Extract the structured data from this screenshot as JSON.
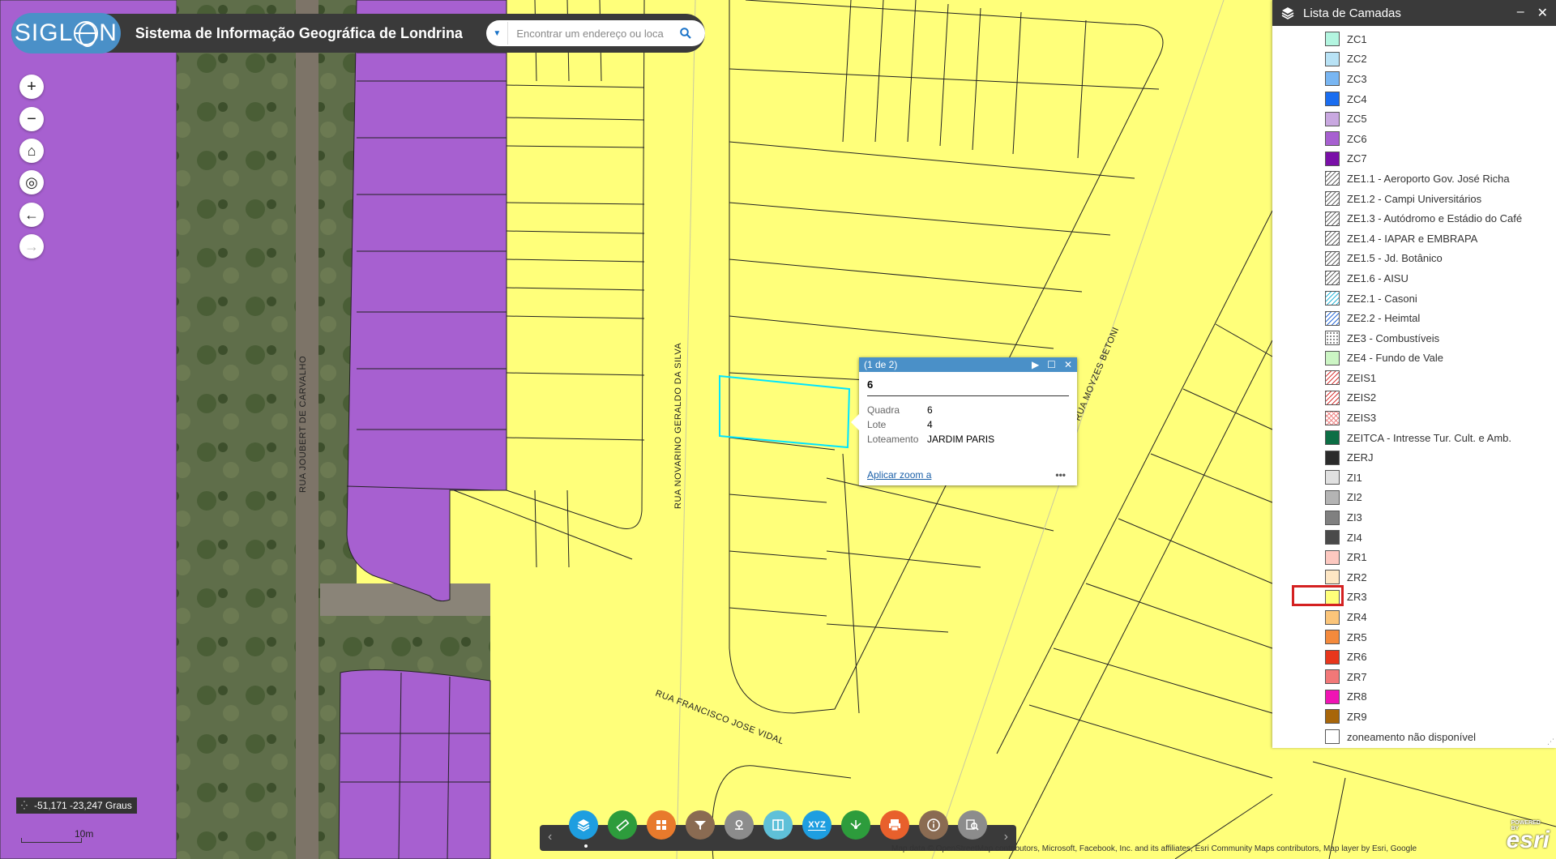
{
  "header": {
    "logo_text": "SIGLON",
    "title": "Sistema de Informação Geográfica de Londrina",
    "search_placeholder": "Encontrar um endereço ou loca"
  },
  "nav": [
    {
      "name": "zoom-in-button",
      "glyph": "+"
    },
    {
      "name": "zoom-out-button",
      "glyph": "−"
    },
    {
      "name": "home-button",
      "glyph": "⌂"
    },
    {
      "name": "locate-button",
      "glyph": "◎"
    },
    {
      "name": "back-extent-button",
      "glyph": "←"
    },
    {
      "name": "forward-extent-button",
      "glyph": "→"
    }
  ],
  "map": {
    "streets": [
      "RUA JOUBERT DE CARVALHO",
      "RUA NOVARINO GERALDO DA SILVA",
      "RUA FRANCISCO JOSE VIDAL",
      "RUA MOYZES BETONI"
    ],
    "colors": {
      "zone_yellow": "#ffff7a",
      "zone_purple": "#a760d0",
      "selection": "#00e5ff"
    }
  },
  "coords": {
    "text": "-51,171 -23,247 Graus"
  },
  "scale": {
    "label": "10m"
  },
  "popup": {
    "counter": "(1 de 2)",
    "title": "6",
    "rows": [
      {
        "key": "Quadra",
        "value": "6"
      },
      {
        "key": "Lote",
        "value": "4"
      },
      {
        "key": "Loteamento",
        "value": "JARDIM PARIS"
      }
    ],
    "zoom_link": "Aplicar zoom a",
    "more": "•••"
  },
  "panel": {
    "title": "Lista de Camadas",
    "items": [
      {
        "label": "ZC1",
        "color": "#b3f5e0",
        "pattern": ""
      },
      {
        "label": "ZC2",
        "color": "#b8e2f5",
        "pattern": ""
      },
      {
        "label": "ZC3",
        "color": "#79b6f2",
        "pattern": ""
      },
      {
        "label": "ZC4",
        "color": "#1a6df0",
        "pattern": ""
      },
      {
        "label": "ZC5",
        "color": "#c9a8e0",
        "pattern": ""
      },
      {
        "label": "ZC6",
        "color": "#a760d0",
        "pattern": ""
      },
      {
        "label": "ZC7",
        "color": "#7a10a8",
        "pattern": ""
      },
      {
        "label": "ZE1.1 - Aeroporto Gov. José Richa",
        "color": "#ffffff",
        "pattern": "hatch"
      },
      {
        "label": "ZE1.2 - Campi Universitários",
        "color": "#ffffff",
        "pattern": "hatch"
      },
      {
        "label": "ZE1.3 - Autódromo e Estádio do Café",
        "color": "#ffffff",
        "pattern": "hatch"
      },
      {
        "label": "ZE1.4 - IAPAR e EMBRAPA",
        "color": "#ffffff",
        "pattern": "hatch"
      },
      {
        "label": "ZE1.5 - Jd. Botânico",
        "color": "#ffffff",
        "pattern": "hatch"
      },
      {
        "label": "ZE1.6 - AISU",
        "color": "#ffffff",
        "pattern": "hatch"
      },
      {
        "label": "ZE2.1 - Casoni",
        "color": "#ffffff",
        "pattern": "hatch-cyan"
      },
      {
        "label": "ZE2.2 - Heimtal",
        "color": "#ffffff",
        "pattern": "hatch-blue"
      },
      {
        "label": "ZE3 - Combustíveis",
        "color": "#ffffff",
        "pattern": "dots"
      },
      {
        "label": "ZE4 - Fundo de Vale",
        "color": "#ccf5c4",
        "pattern": ""
      },
      {
        "label": "ZEIS1",
        "color": "#ffffff",
        "pattern": "hatch-red"
      },
      {
        "label": "ZEIS2",
        "color": "#ffffff",
        "pattern": "hatch-red"
      },
      {
        "label": "ZEIS3",
        "color": "#ffffff",
        "pattern": "cross-red"
      },
      {
        "label": "ZEITCA - Intresse Tur. Cult. e Amb.",
        "color": "#0d6e45",
        "pattern": ""
      },
      {
        "label": "ZERJ",
        "color": "#2b2b2b",
        "pattern": ""
      },
      {
        "label": "ZI1",
        "color": "#e0e0e0",
        "pattern": ""
      },
      {
        "label": "ZI2",
        "color": "#b4b4b4",
        "pattern": ""
      },
      {
        "label": "ZI3",
        "color": "#808080",
        "pattern": ""
      },
      {
        "label": "ZI4",
        "color": "#4a4a4a",
        "pattern": ""
      },
      {
        "label": "ZR1",
        "color": "#fcc8c0",
        "pattern": ""
      },
      {
        "label": "ZR2",
        "color": "#fde6c4",
        "pattern": ""
      },
      {
        "label": "ZR3",
        "color": "#ffff7a",
        "pattern": ""
      },
      {
        "label": "ZR4",
        "color": "#fbc57a",
        "pattern": ""
      },
      {
        "label": "ZR5",
        "color": "#f48a3c",
        "pattern": ""
      },
      {
        "label": "ZR6",
        "color": "#e8361c",
        "pattern": ""
      },
      {
        "label": "ZR7",
        "color": "#f27878",
        "pattern": ""
      },
      {
        "label": "ZR8",
        "color": "#f014b4",
        "pattern": ""
      },
      {
        "label": "ZR9",
        "color": "#a8660a",
        "pattern": ""
      },
      {
        "label": "zoneamento não disponível",
        "color": "#ffffff",
        "pattern": ""
      }
    ]
  },
  "toolbar": {
    "tools": [
      {
        "name": "layers-tool",
        "color": "#1e9ee0",
        "glyph": "layers"
      },
      {
        "name": "measure-tool",
        "color": "#2d9c3c",
        "glyph": "ruler"
      },
      {
        "name": "basemap-tool",
        "color": "#e87a2c",
        "glyph": "grid"
      },
      {
        "name": "query-tool",
        "color": "#8a6b52",
        "glyph": "filter"
      },
      {
        "name": "locate-tool",
        "color": "#8c8c8c",
        "glyph": "pin"
      },
      {
        "name": "swipe-tool",
        "color": "#5fc0d8",
        "glyph": "swipe"
      },
      {
        "name": "coordinates-tool",
        "color": "#1e9ee0",
        "glyph": "xyz"
      },
      {
        "name": "share-tool",
        "color": "#2d9c3c",
        "glyph": "share"
      },
      {
        "name": "print-tool",
        "color": "#e8602c",
        "glyph": "print"
      },
      {
        "name": "info-tool",
        "color": "#8a6b52",
        "glyph": "info"
      },
      {
        "name": "search-tool",
        "color": "#8c8c8c",
        "glyph": "search"
      }
    ],
    "xyz_label": "XYZ"
  },
  "attribution": "Map data © OpenStreetMap contributors, Microsoft, Facebook, Inc. and its affiliates, Esri Community Maps contributors, Map layer by Esri, Google",
  "esri": {
    "powered": "POWERED BY",
    "brand": "esri"
  }
}
